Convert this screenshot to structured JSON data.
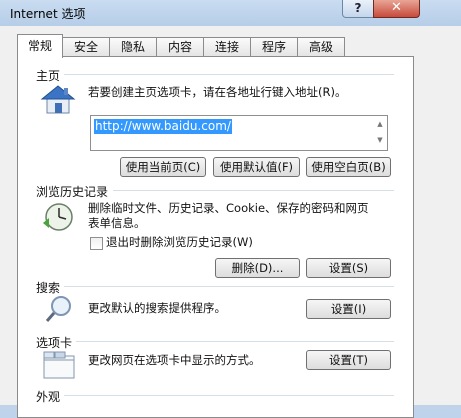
{
  "window": {
    "title": "Internet 选项",
    "help": "?",
    "close": "✕"
  },
  "tabs": [
    "常规",
    "安全",
    "隐私",
    "内容",
    "连接",
    "程序",
    "高级"
  ],
  "homepage": {
    "title": "主页",
    "description": "若要创建主页选项卡，请在各地址行键入地址(R)。",
    "url": "http://www.baidu.com/",
    "buttons": [
      "使用当前页(C)",
      "使用默认值(F)",
      "使用空白页(B)"
    ]
  },
  "history": {
    "title": "浏览历史记录",
    "description_line1": "删除临时文件、历史记录、Cookie、保存的密码和网页",
    "description_line2": "表单信息。",
    "checkbox_label": "退出时删除浏览历史记录(W)",
    "delete_button": "删除(D)...",
    "settings_button": "设置(S)"
  },
  "search": {
    "title": "搜索",
    "description": "更改默认的搜索提供程序。",
    "settings_button": "设置(I)"
  },
  "tabs_section": {
    "title": "选项卡",
    "description": "更改网页在选项卡中显示的方式。",
    "settings_button": "设置(T)"
  },
  "appearance": {
    "title": "外观"
  }
}
